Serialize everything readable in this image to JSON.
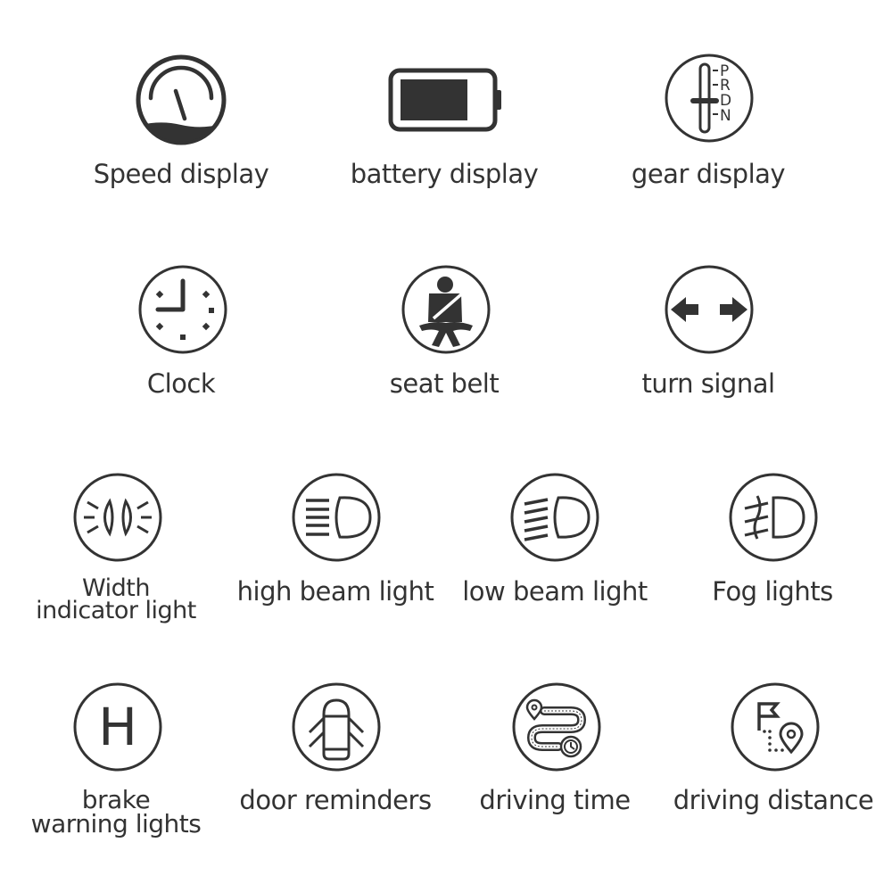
{
  "colors": {
    "ink": "#333333",
    "background": "#ffffff"
  },
  "rows": [
    {
      "items": [
        {
          "id": "speed",
          "icon": "speedometer-icon",
          "label": "Speed display"
        },
        {
          "id": "battery",
          "icon": "battery-icon",
          "label": "battery display"
        },
        {
          "id": "gear",
          "icon": "gear-shift-icon",
          "label": "gear display",
          "gear_letters": [
            "P",
            "R",
            "D",
            "N"
          ]
        }
      ]
    },
    {
      "items": [
        {
          "id": "clock",
          "icon": "clock-icon",
          "label": "Clock"
        },
        {
          "id": "seatbelt",
          "icon": "seat-belt-icon",
          "label": "seat belt"
        },
        {
          "id": "turn",
          "icon": "turn-signal-icon",
          "label": "turn signal"
        }
      ]
    },
    {
      "items": [
        {
          "id": "width",
          "icon": "width-indicator-icon",
          "label_line1": "Width",
          "label_line2": "indicator light"
        },
        {
          "id": "highbeam",
          "icon": "high-beam-icon",
          "label": "high beam light"
        },
        {
          "id": "lowbeam",
          "icon": "low-beam-icon",
          "label": "low beam light"
        },
        {
          "id": "fog",
          "icon": "fog-light-icon",
          "label": "Fog lights"
        }
      ]
    },
    {
      "items": [
        {
          "id": "brake",
          "icon": "brake-warning-icon",
          "label_line1": "brake",
          "label_line2": "warning lights",
          "glyph": "H"
        },
        {
          "id": "door",
          "icon": "door-open-icon",
          "label": "door reminders"
        },
        {
          "id": "drivetime",
          "icon": "driving-time-icon",
          "label": "driving time"
        },
        {
          "id": "drivedist",
          "icon": "driving-distance-icon",
          "label": "driving distance"
        }
      ]
    }
  ]
}
